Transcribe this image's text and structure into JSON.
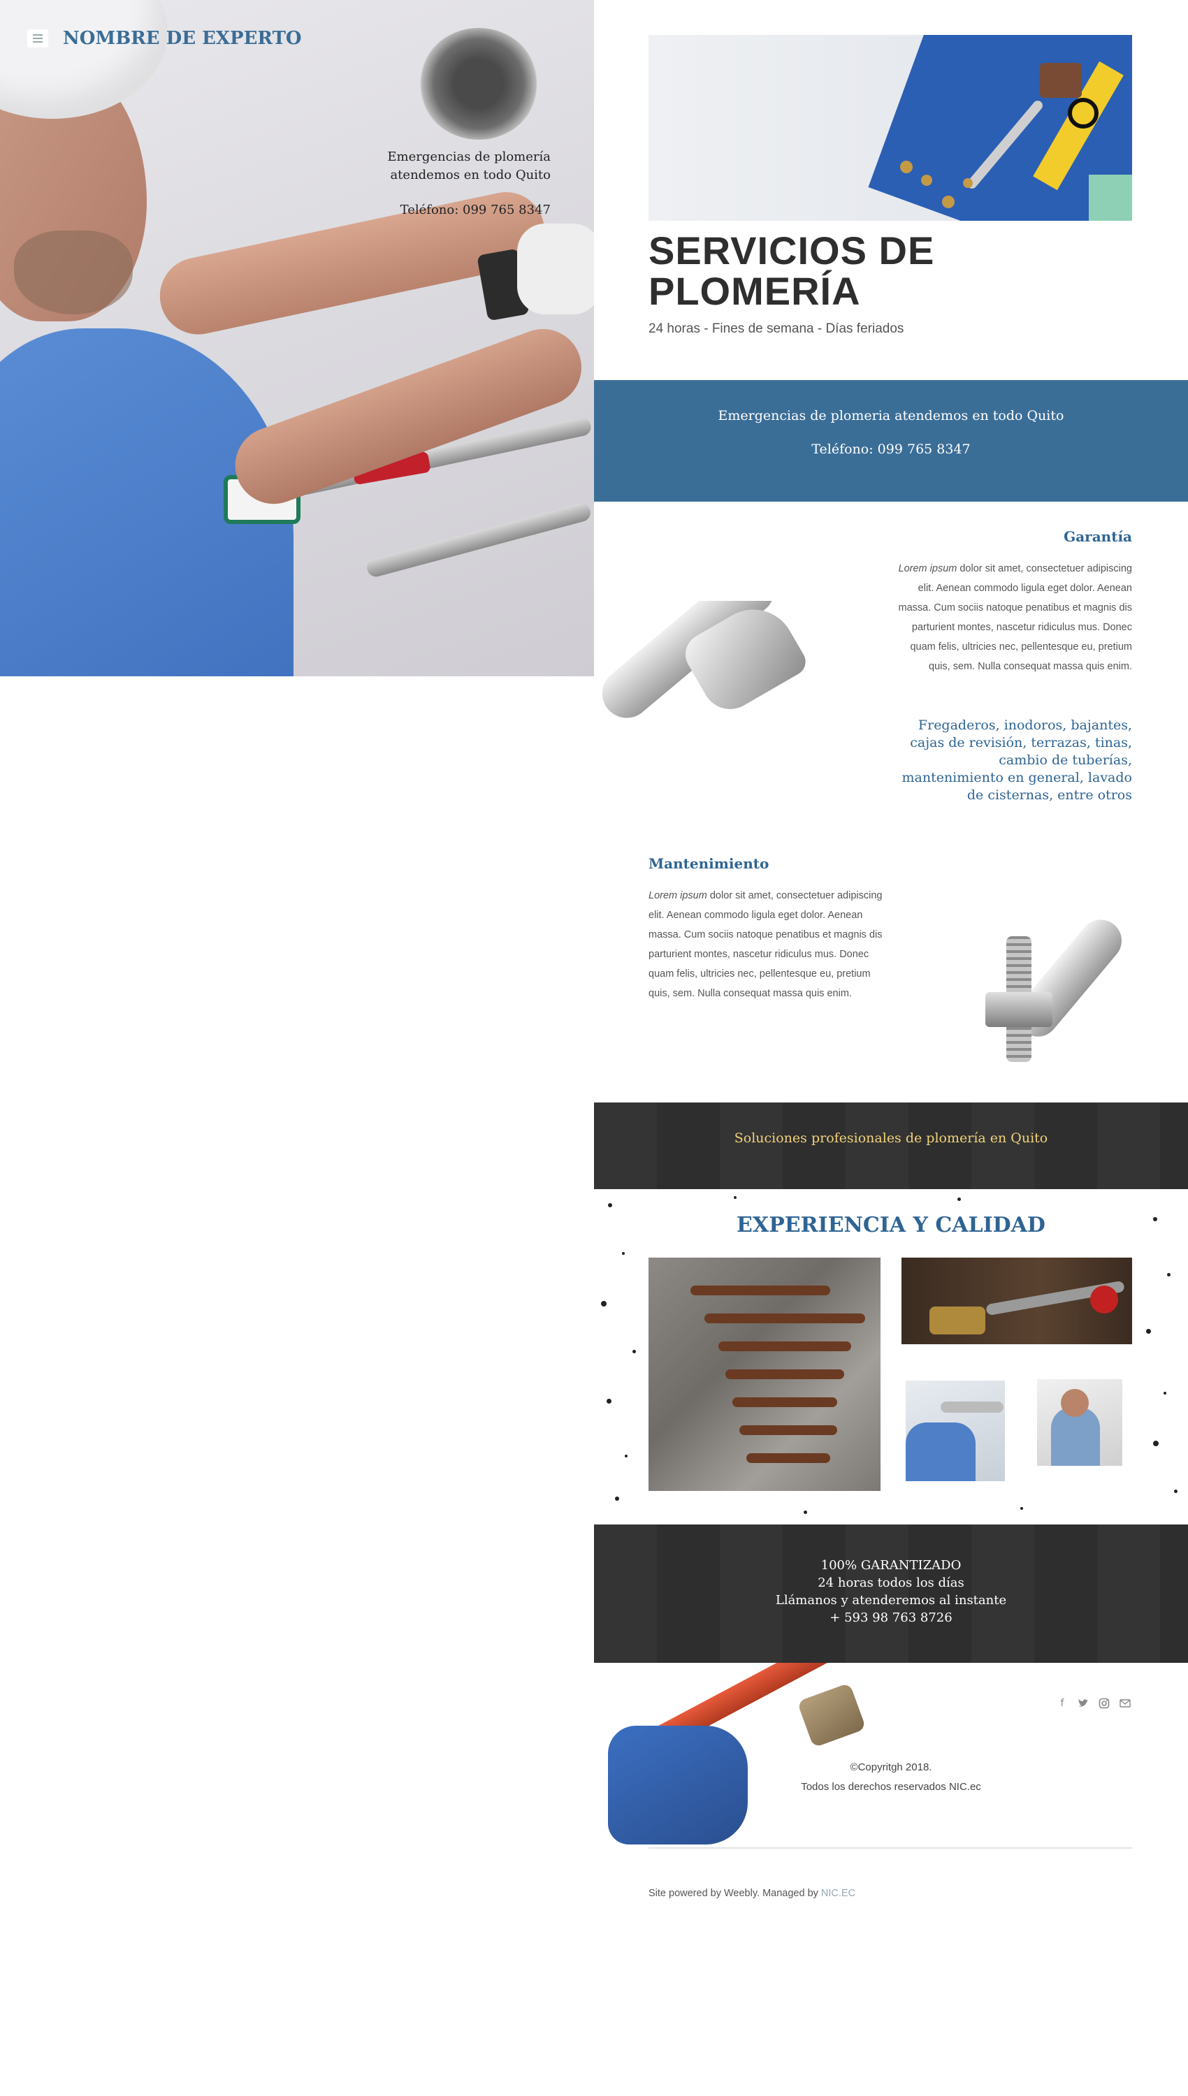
{
  "header": {
    "site_title": "NOMBRE DE EXPERTO",
    "hero_line1": "Emergencias de plomería",
    "hero_line2": "atendemos en todo Quito",
    "hero_phone": "Teléfono: 099 765 8347"
  },
  "services": {
    "title_line1": "SERVICIOS DE",
    "title_line2": "PLOMERÍA",
    "subtitle": "24 horas - Fines de semana - Días feriados"
  },
  "blue_band": {
    "line1": "Emergencias de plomeria atendemos en todo Quito",
    "line2": "Teléfono: 099 765 8347"
  },
  "garantia": {
    "title": "Garantía",
    "lorem_lead": "Lorem ipsum",
    "body": " dolor sit amet, consectetuer adipiscing elit. Aenean commodo ligula eget dolor. Aenean massa. Cum sociis natoque penatibus et magnis dis parturient montes, nascetur ridiculus mus. Donec quam felis, ultricies nec, pellentesque eu, pretium quis, sem. Nulla consequat massa quis enim.",
    "list": "Fregaderos, inodoros, bajantes, cajas de revisión, terrazas, tinas, cambio de tuberías, mantenimiento en general, lavado de cisternas, entre otros"
  },
  "mantenimiento": {
    "title": "Mantenimiento",
    "lorem_lead": "Lorem ipsum",
    "body": " dolor sit amet, consectetuer adipiscing elit. Aenean commodo ligula eget dolor. Aenean massa. Cum sociis natoque penatibus et magnis dis parturient montes, nascetur ridiculus mus. Donec quam felis, ultricies nec, pellentesque eu, pretium quis, sem. Nulla consequat massa quis enim."
  },
  "solutions_band": {
    "text": "Soluciones profesionales de plomería en Quito"
  },
  "experiencia": {
    "title": "EXPERIENCIA Y CALIDAD"
  },
  "guarantee_band": {
    "line1": "100% GARANTIZADO",
    "line2": "24 horas todos los días",
    "line3": "Llámanos y atenderemos al instante",
    "line4": "+ 593 98 763 8726"
  },
  "footer": {
    "social_icons": [
      "facebook-icon",
      "twitter-icon",
      "instagram-icon",
      "mail-icon"
    ],
    "copyright_line1": "©Copyritgh 2018.",
    "copyright_line2": "Todos los derechos reservados NIC.ec",
    "powered_text": "Site powered by Weebly. Managed by ",
    "powered_link": "NIC.EC"
  },
  "colors": {
    "accent_blue": "#3b6e97",
    "heading_blue": "#2e6493",
    "dark_band": "#333333",
    "yellow_text": "#f2d27a"
  }
}
